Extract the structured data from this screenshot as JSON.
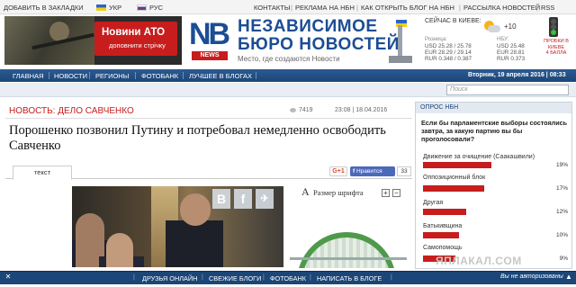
{
  "topbar": {
    "bookmarks": "ДОБАВИТЬ В ЗАКЛАДКИ",
    "ukr": "УКР",
    "rus": "РУС",
    "contacts": "КОНТАКТЫ",
    "ads": "РЕКЛАМА НА НБН",
    "blog": "КАК ОТКРЫТЬ БЛОГ НА НБН",
    "newsletter": "РАССЫЛКА НОВОСТЕЙ",
    "rss": "RSS"
  },
  "banner": {
    "title": "Новини АТО",
    "subtitle": "доповнити стрічку"
  },
  "brand": {
    "logo_letters": "NB",
    "logo_news": "NEWS",
    "name_line1": "НЕЗАВИСИМОЕ",
    "name_line2": "БЮРО НОВОСТЕЙ",
    "tagline": "Место, где создаются Новости"
  },
  "weather": {
    "label": "СЕЙЧАС В КИЕВЕ:",
    "temp": "+10",
    "rates_label_left": "Розница:",
    "rates_left": [
      "USD 25.28 / 25.78",
      "EUR 28.29 / 29.14",
      "RUR 0.348 / 0.387"
    ],
    "rates_label_right": "НБУ:",
    "rates_right": [
      "USD 25.48",
      "EUR 28.81",
      "RUR 0.373"
    ],
    "traffic_label": "ПРОБКИ В КИЕВЕ",
    "traffic_level": "4 БАЛЛА"
  },
  "nav": {
    "items": [
      "ГЛАВНАЯ",
      "НОВОСТИ",
      "РЕГИОНЫ",
      "ФОТОБАНК",
      "ЛУЧШЕЕ В БЛОГАХ"
    ],
    "datetime": "Вторник, 19 апреля 2016 | 08:33",
    "search_placeholder": "Поиск"
  },
  "article": {
    "category": "НОВОСТЬ: ДЕЛО САВЧЕНКО",
    "views": "7419",
    "time": "23:08 | 18.04.2016",
    "headline": "Порошенко позвонил Путину и потребовал немедленно освободить Савченко",
    "tab": "текст",
    "gplus": "G+1",
    "fb_like": "Нравится",
    "fb_count": "33",
    "font_size_label": "Размер шрифта",
    "font_plus": "+",
    "font_minus": "−",
    "share_b": "B",
    "share_f": "f"
  },
  "poll": {
    "header": "ОПРОС НБН",
    "question": "Если бы парламентские выборы состоялись завтра, за какую партию вы бы проголосовали?",
    "options": [
      {
        "label": "Движение за очищение (Саакашвили)",
        "pct": "19%",
        "value": 19
      },
      {
        "label": "Оппозиционный блок",
        "pct": "17%",
        "value": 17
      },
      {
        "label": "Другая",
        "pct": "12%",
        "value": 12
      },
      {
        "label": "Батькивщина",
        "pct": "10%",
        "value": 10
      },
      {
        "label": "Самопомощь",
        "pct": "9%",
        "value": 9
      }
    ],
    "colors": {
      "bar": "#c71d1d"
    }
  },
  "watermark": {
    "text": "ЯПЛАКАЛ.COM"
  },
  "bottombar": {
    "items": [
      "ДРУЗЬЯ ОНЛАЙН",
      "СВЕЖИЕ БЛОГИ",
      "ФОТОБАНК",
      "НАПИСАТЬ В БЛОГЕ"
    ],
    "auth": "Вы не авторизованы",
    "close": "✕",
    "up": "▲"
  }
}
